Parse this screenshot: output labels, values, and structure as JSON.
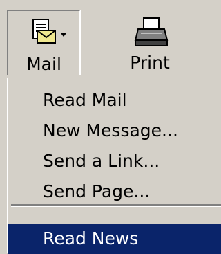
{
  "toolbar": {
    "mail": {
      "label": "Mail",
      "icon": "mail-envelope-icon"
    },
    "print": {
      "label": "Print",
      "icon": "printer-icon"
    }
  },
  "menu": {
    "items": [
      {
        "label": "Read Mail"
      },
      {
        "label": "New Message..."
      },
      {
        "label": "Send a Link..."
      },
      {
        "label": "Send Page..."
      },
      {
        "label": "Read News",
        "selected": true
      }
    ]
  },
  "colors": {
    "face": "#d4d0c8",
    "highlight": "#0a246a",
    "highlight_text": "#ffffff"
  }
}
